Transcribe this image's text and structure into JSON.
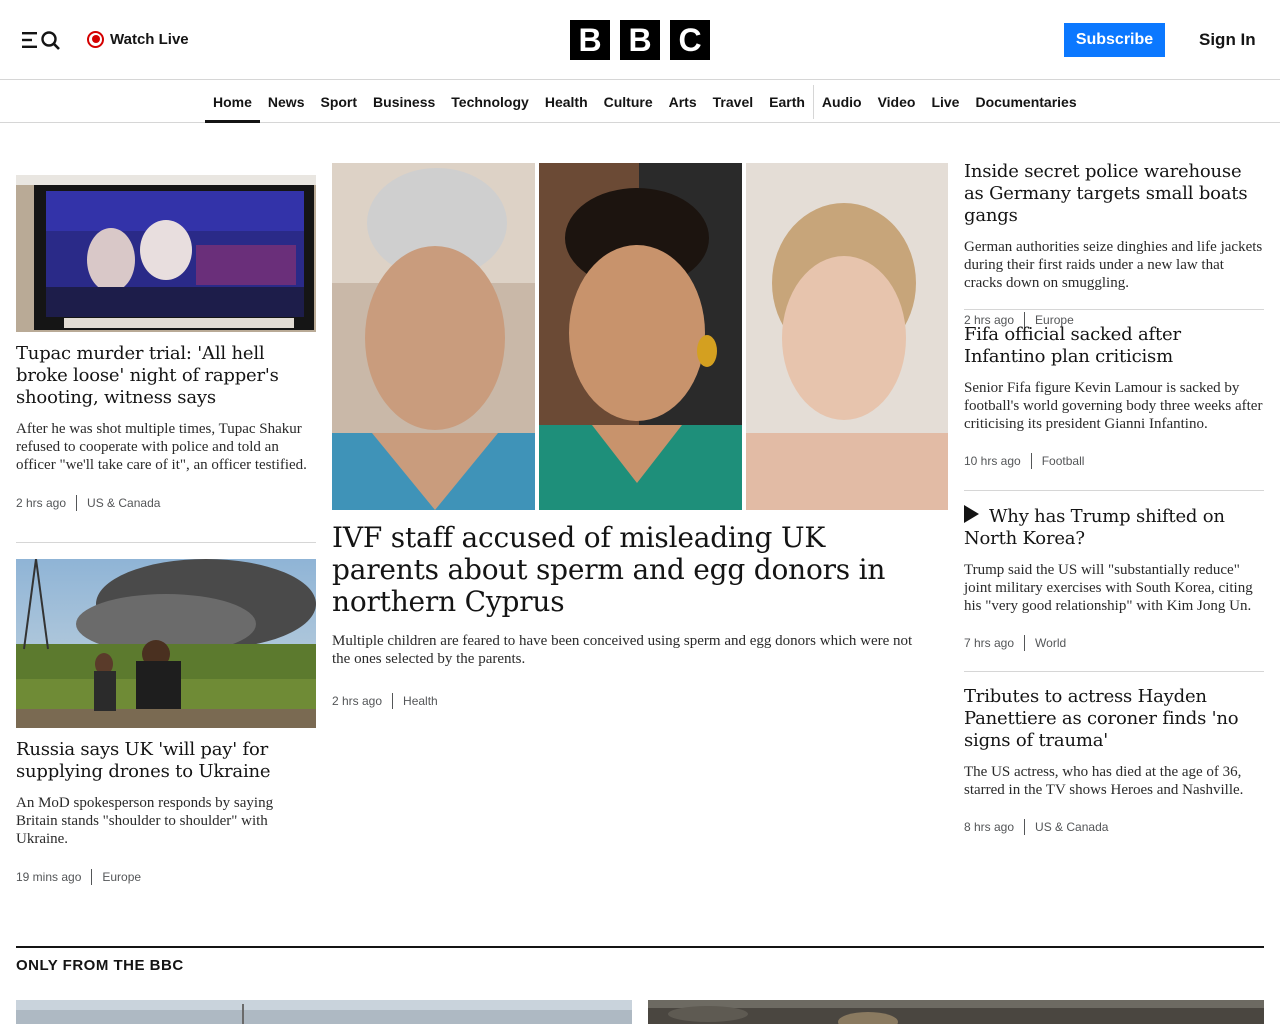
{
  "header": {
    "watch_live": "Watch Live",
    "logo_letters": [
      "B",
      "B",
      "C"
    ],
    "subscribe": "Subscribe",
    "sign_in": "Sign In"
  },
  "nav": {
    "items": [
      "Home",
      "News",
      "Sport",
      "Business",
      "Technology",
      "Health",
      "Culture",
      "Arts",
      "Travel",
      "Earth",
      "Audio",
      "Video",
      "Live",
      "Documentaries"
    ],
    "active": "Home"
  },
  "left_stories": [
    {
      "headline": "Tupac murder trial: 'All hell broke loose' night of rapper's shooting, witness says",
      "summary": "After he was shot multiple times, Tupac Shakur refused to cooperate with police and told an officer \"we'll take care of it\", an officer testified.",
      "time": "2 hrs ago",
      "section": "US & Canada"
    },
    {
      "headline": "Russia says UK 'will pay' for supplying drones to Ukraine",
      "summary": "An MoD spokesperson responds by saying Britain stands \"shoulder to shoulder\" with Ukraine.",
      "time": "19 mins ago",
      "section": "Europe"
    }
  ],
  "main_story": {
    "headline": "IVF staff accused of misleading UK parents about sperm and egg donors in northern Cyprus",
    "summary": "Multiple children are feared to have been conceived using sperm and egg donors which were not the ones selected by the parents.",
    "time": "2 hrs ago",
    "section": "Health"
  },
  "right_stories": [
    {
      "headline": "Inside secret police warehouse as Germany targets small boats gangs",
      "summary": "German authorities seize dinghies and life jackets during their first raids under a new law that cracks down on smuggling.",
      "time": "2 hrs ago",
      "section": "Europe"
    },
    {
      "headline": "Fifa official sacked after Infantino plan criticism",
      "summary": "Senior Fifa figure Kevin Lamour is sacked by football's world governing body three weeks after criticising its president Gianni Infantino.",
      "time": "10 hrs ago",
      "section": "Football"
    },
    {
      "headline": "Why has Trump shifted on North Korea?",
      "summary": "Trump said the US will \"substantially reduce\" joint military exercises with South Korea, citing his \"very good relationship\" with Kim Jong Un.",
      "time": "7 hrs ago",
      "section": "World"
    },
    {
      "headline": "Tributes to actress Hayden Panettiere as coroner finds 'no signs of trauma'",
      "summary": "The US actress, who has died at the age of 36, starred in the TV shows Heroes and Nashville.",
      "time": "8 hrs ago",
      "section": "US & Canada"
    }
  ],
  "section": {
    "title": "ONLY FROM THE BBC"
  },
  "colors": {
    "subscribe_bg": "#0b78ff",
    "live_red": "#d40000"
  }
}
